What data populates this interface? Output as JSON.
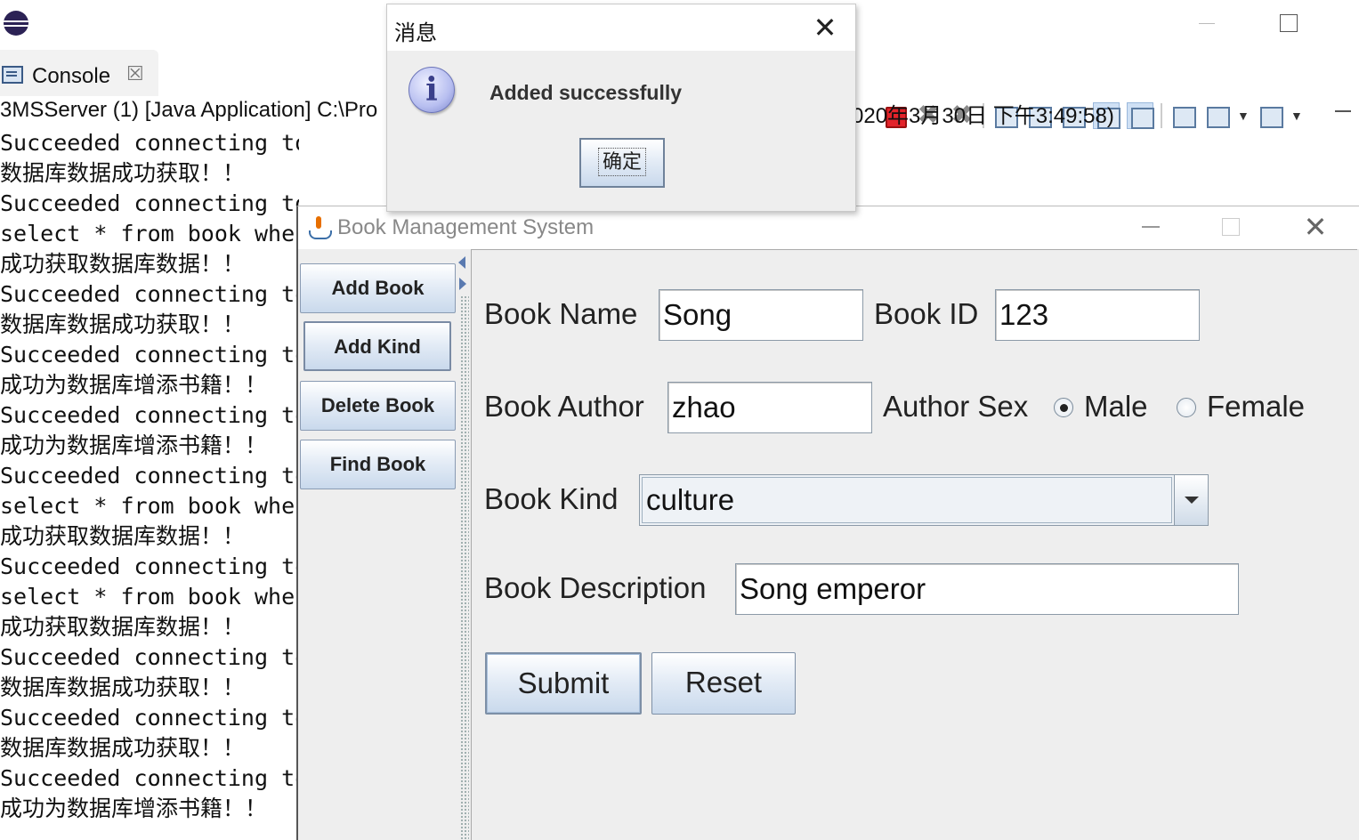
{
  "ide": {
    "console_tab_label": "Console",
    "console_tab_close": "☒",
    "launch_status_left": "3MSServer (1) [Java Application] C:\\Pro",
    "launch_status_right": "020年3月30日 下午3:49:58)",
    "console_lines": [
      "Succeeded connecting to the Da",
      "数据库数据成功获取！！",
      "Succeeded connecting to the Da",
      "select * from book wher",
      "成功获取数据库数据！！",
      "Succeeded connecting to",
      "数据库数据成功获取！！",
      "Succeeded connecting to",
      "成功为数据库增添书籍！！",
      "Succeeded connecting to",
      "成功为数据库增添书籍！！",
      "Succeeded connecting to",
      "select * from book wher",
      "成功获取数据库数据！！",
      "Succeeded connecting to",
      "select * from book wher",
      "成功获取数据库数据！！",
      "Succeeded connecting to",
      "数据库数据成功获取！！",
      "Succeeded connecting to",
      "数据库数据成功获取！！",
      "Succeeded connecting to",
      "成功为数据库增添书籍！！"
    ]
  },
  "bms": {
    "title": "Book Management System",
    "close_glyph": "✕",
    "sidebar": {
      "add_book": "Add Book",
      "add_kind": "Add Kind",
      "delete_book": "Delete Book",
      "find_book": "Find Book"
    },
    "form": {
      "book_name_label": "Book Name",
      "book_name_value": "Song",
      "book_id_label": "Book ID",
      "book_id_value": "123",
      "book_author_label": "Book Author",
      "book_author_value": "zhao",
      "author_sex_label": "Author Sex",
      "sex_male": "Male",
      "sex_female": "Female",
      "sex_selected": "Male",
      "book_kind_label": "Book Kind",
      "book_kind_value": "culture",
      "book_description_label": "Book Description",
      "book_description_value": "Song emperor",
      "submit": "Submit",
      "reset": "Reset"
    }
  },
  "dialog": {
    "title": "消息",
    "close_glyph": "✕",
    "icon_glyph": "i",
    "message": "Added successfully",
    "ok_label": "确定"
  }
}
